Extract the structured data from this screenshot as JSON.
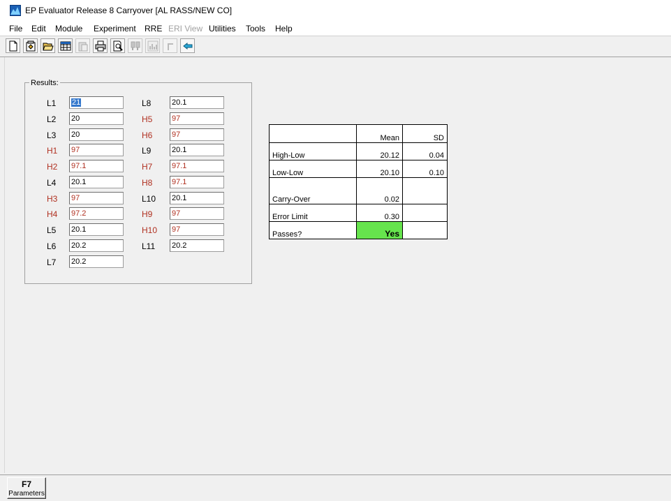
{
  "window": {
    "title": "EP Evaluator Release 8 Carryover  [AL RASS/NEW CO]"
  },
  "menu": [
    "File",
    "Edit",
    "Module",
    "Experiment",
    "RRE",
    "ERI View",
    "Utilities",
    "Tools",
    "Help"
  ],
  "menu_disabled": [
    "ERI View"
  ],
  "toolbar": {
    "buttons": [
      {
        "icon": "new-document-icon",
        "enabled": true
      },
      {
        "icon": "new-experiment-icon",
        "enabled": true
      },
      {
        "icon": "open-folder-icon",
        "enabled": true
      },
      {
        "icon": "grid-icon",
        "enabled": true
      },
      {
        "icon": "paste-icon",
        "enabled": false
      },
      {
        "icon": "print-icon",
        "enabled": true
      },
      {
        "icon": "print-preview-icon",
        "enabled": true
      },
      {
        "icon": "find-icon",
        "enabled": false
      },
      {
        "icon": "chart-icon",
        "enabled": false
      },
      {
        "icon": "undo-icon",
        "enabled": false
      },
      {
        "icon": "back-arrow-icon",
        "enabled": true
      }
    ]
  },
  "results": {
    "group_label": "Results:",
    "left_column": [
      {
        "label": "L1",
        "value": "21",
        "high": false,
        "selected": true
      },
      {
        "label": "L2",
        "value": "20",
        "high": false
      },
      {
        "label": "L3",
        "value": "20",
        "high": false
      },
      {
        "label": "H1",
        "value": "97",
        "high": true
      },
      {
        "label": "H2",
        "value": "97.1",
        "high": true
      },
      {
        "label": "L4",
        "value": "20.1",
        "high": false
      },
      {
        "label": "H3",
        "value": "97",
        "high": true
      },
      {
        "label": "H4",
        "value": "97.2",
        "high": true
      },
      {
        "label": "L5",
        "value": "20.1",
        "high": false
      },
      {
        "label": "L6",
        "value": "20.2",
        "high": false
      },
      {
        "label": "L7",
        "value": "20.2",
        "high": false
      }
    ],
    "right_column": [
      {
        "label": "L8",
        "value": "20.1",
        "high": false
      },
      {
        "label": "H5",
        "value": "97",
        "high": true
      },
      {
        "label": "H6",
        "value": "97",
        "high": true
      },
      {
        "label": "L9",
        "value": "20.1",
        "high": false
      },
      {
        "label": "H7",
        "value": "97.1",
        "high": true
      },
      {
        "label": "H8",
        "value": "97.1",
        "high": true
      },
      {
        "label": "L10",
        "value": "20.1",
        "high": false
      },
      {
        "label": "H9",
        "value": "97",
        "high": true
      },
      {
        "label": "H10",
        "value": "97",
        "high": true
      },
      {
        "label": "L11",
        "value": "20.2",
        "high": false
      }
    ]
  },
  "stats": {
    "headers": {
      "mean": "Mean",
      "sd": "SD"
    },
    "high_low": {
      "label": "High-Low",
      "mean": "20.12",
      "sd": "0.04"
    },
    "low_low": {
      "label": "Low-Low",
      "mean": "20.10",
      "sd": "0.10"
    },
    "carry_over": {
      "label": "Carry-Over",
      "mean": "0.02"
    },
    "error_limit": {
      "label": "Error Limit",
      "mean": "0.30"
    },
    "passes": {
      "label": "Passes?",
      "value": "Yes"
    }
  },
  "colors": {
    "high_label": "#b03020",
    "pass_fill": "#66e44d",
    "selection": "#3377cc"
  },
  "footer": {
    "f7_key": "F7",
    "f7_label": "Parameters"
  }
}
